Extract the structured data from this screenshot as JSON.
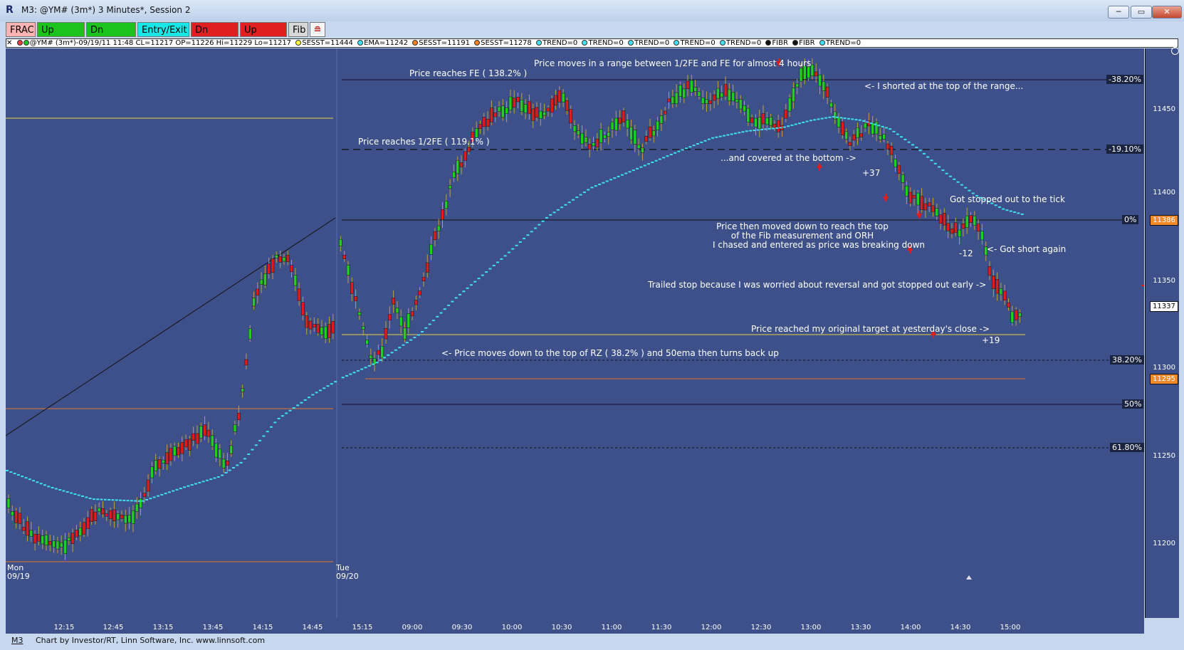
{
  "window": {
    "title": "M3: @YM# (3m*) 3 Minutes*, Session 2",
    "minimize": "─",
    "maximize": "▭",
    "close": "✕"
  },
  "toolbar": {
    "buttons": [
      {
        "label": "FRAC",
        "bg": "#ffb3b3",
        "fg": "#000000"
      },
      {
        "label": "Up Arrow",
        "bg": "#1dc31d",
        "fg": "#000000"
      },
      {
        "label": "Dn Arrow",
        "bg": "#1dc31d",
        "fg": "#000000"
      },
      {
        "label": "Entry/Exit",
        "bg": "#19e6e6",
        "fg": "#000000"
      },
      {
        "label": "Dn Arrow",
        "bg": "#e02020",
        "fg": "#000000"
      },
      {
        "label": "Up Arrow",
        "bg": "#e02020",
        "fg": "#000000"
      },
      {
        "label": "Fib",
        "bg": "#d8d8d8",
        "fg": "#000000"
      }
    ]
  },
  "legend": {
    "close_x": "✕",
    "items": [
      {
        "text": "@YM# (3m*)-09/19/11 11:48 CL=11217 OP=11226 Hi=11229 Lo=11217",
        "dot": "#e04040"
      },
      {
        "text": "SESST=11444",
        "dot": "#ffff40"
      },
      {
        "text": "EMA=11242",
        "dot": "#40e0f0"
      },
      {
        "text": "SESST=11191",
        "dot": "#f08020"
      },
      {
        "text": "SESST=11278",
        "dot": "#f08020"
      },
      {
        "text": "TREND=0",
        "dot": "#40e0f0"
      },
      {
        "text": "TREND=0",
        "dot": "#40e0f0"
      },
      {
        "text": "TREND=0",
        "dot": "#40e0f0"
      },
      {
        "text": "TREND=0",
        "dot": "#40e0f0"
      },
      {
        "text": "TREND=0",
        "dot": "#40e0f0"
      },
      {
        "text": "FIBR",
        "dot": "#111111"
      },
      {
        "text": "FIBR",
        "dot": "#111111"
      },
      {
        "text": "TREND=0",
        "dot": "#40e0f0"
      }
    ]
  },
  "price_axis": {
    "ticks": [
      "11450",
      "11400",
      "11350",
      "11300",
      "11250",
      "11200"
    ],
    "tag_11386": "11386",
    "tag_11337": "11337",
    "tag_11295": "11295"
  },
  "fib_levels": [
    "-38.20%",
    "-19.10%",
    "0%",
    "38.20%",
    "50%",
    "61.80%"
  ],
  "time_axis": [
    "12:15",
    "12:45",
    "13:15",
    "13:45",
    "14:15",
    "14:45",
    "15:15",
    "09:00",
    "09:30",
    "10:00",
    "10:30",
    "11:00",
    "11:30",
    "12:00",
    "12:30",
    "13:00",
    "13:30",
    "14:00",
    "14:30",
    "15:00"
  ],
  "sessions": {
    "mon_day": "Mon",
    "mon_date": "09/19",
    "tue_day": "Tue",
    "tue_date": "09/20"
  },
  "annotations": {
    "range": "Price moves in a range between 1/2FE and FE for almost 4 hours",
    "fe": "Price reaches FE ( 138.2% )",
    "shorted": "<- I shorted at the top of the range...",
    "half_fe": "Price reaches 1/2FE ( 119.1% )",
    "covered": "...and covered at the bottom ->",
    "plus37": "+37",
    "stopped": "Got stopped out to the tick",
    "moved_down_1": "Price then moved down to reach the top",
    "moved_down_2": "of the Fib measurement and ORH",
    "moved_down_3": "I chased and entered as price was breaking down",
    "minus12": "-12",
    "short_again": "<- Got short again",
    "trailed": "Trailed stop because I was worried about reversal and got stopped out early ->",
    "target": "Price reached my original target at yesterday's close ->",
    "plus19": "+19",
    "rz": "<- Price moves down to the top of RZ ( 38.2% ) and 50ema then turns back up"
  },
  "status": {
    "tab": "M3",
    "credit": "Chart by Investor/RT, Linn Software, Inc. www.linnsoft.com"
  },
  "colors": {
    "plot_bg": "#3d508a",
    "up_candle": "#22d022",
    "down_candle": "#e01c1c",
    "ema": "#3ee0f0",
    "yellow_line": "#e8d040",
    "orange_line": "#e8762a",
    "arrow": "#e01c1c"
  }
}
